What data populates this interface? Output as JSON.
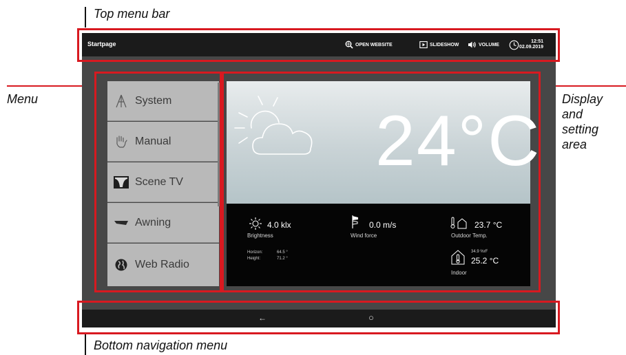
{
  "callouts": {
    "top_menu_bar": "Top menu bar",
    "menu": "Menu",
    "display_area": [
      "Display",
      "and",
      "setting",
      "area"
    ],
    "bottom_navigation": "Bottom navigation menu"
  },
  "topbar": {
    "title": "Startpage",
    "open_website": "OPEN WEBSITE",
    "slideshow": "SLIDESHOW",
    "volume": "VOLUME",
    "time": "12:51",
    "date": "02.09.2019"
  },
  "menu": [
    {
      "label": "System",
      "icon": "system-icon"
    },
    {
      "label": "Manual",
      "icon": "hand-icon"
    },
    {
      "label": "Scene TV",
      "icon": "scene-tv-icon"
    },
    {
      "label": "Awning",
      "icon": "awning-icon"
    },
    {
      "label": "Web Radio",
      "icon": "globe-icon"
    }
  ],
  "weather": {
    "temperature": "24°C",
    "brightness_value": "4.0 klx",
    "brightness_label": "Brightness",
    "horizon_label": "Horizon:",
    "horizon_value": "64.5 °",
    "height_label": "Height:",
    "height_value": "71.2 °",
    "wind_value": "0.0 m/s",
    "wind_label": "Wind force",
    "outdoor_value": "23.7 °C",
    "outdoor_label": "Outdoor Temp.",
    "humidity_value": "34.9 %rF",
    "indoor_value": "25.2 °C",
    "indoor_label": "Indoor"
  },
  "navbar": {
    "back_symbol": "←",
    "home_symbol": "○"
  },
  "colors": {
    "annotation_red": "#d81920",
    "bar_dark": "#1b1b1b",
    "screen_gray": "#474747",
    "menu_gray": "#b9b9b9"
  }
}
